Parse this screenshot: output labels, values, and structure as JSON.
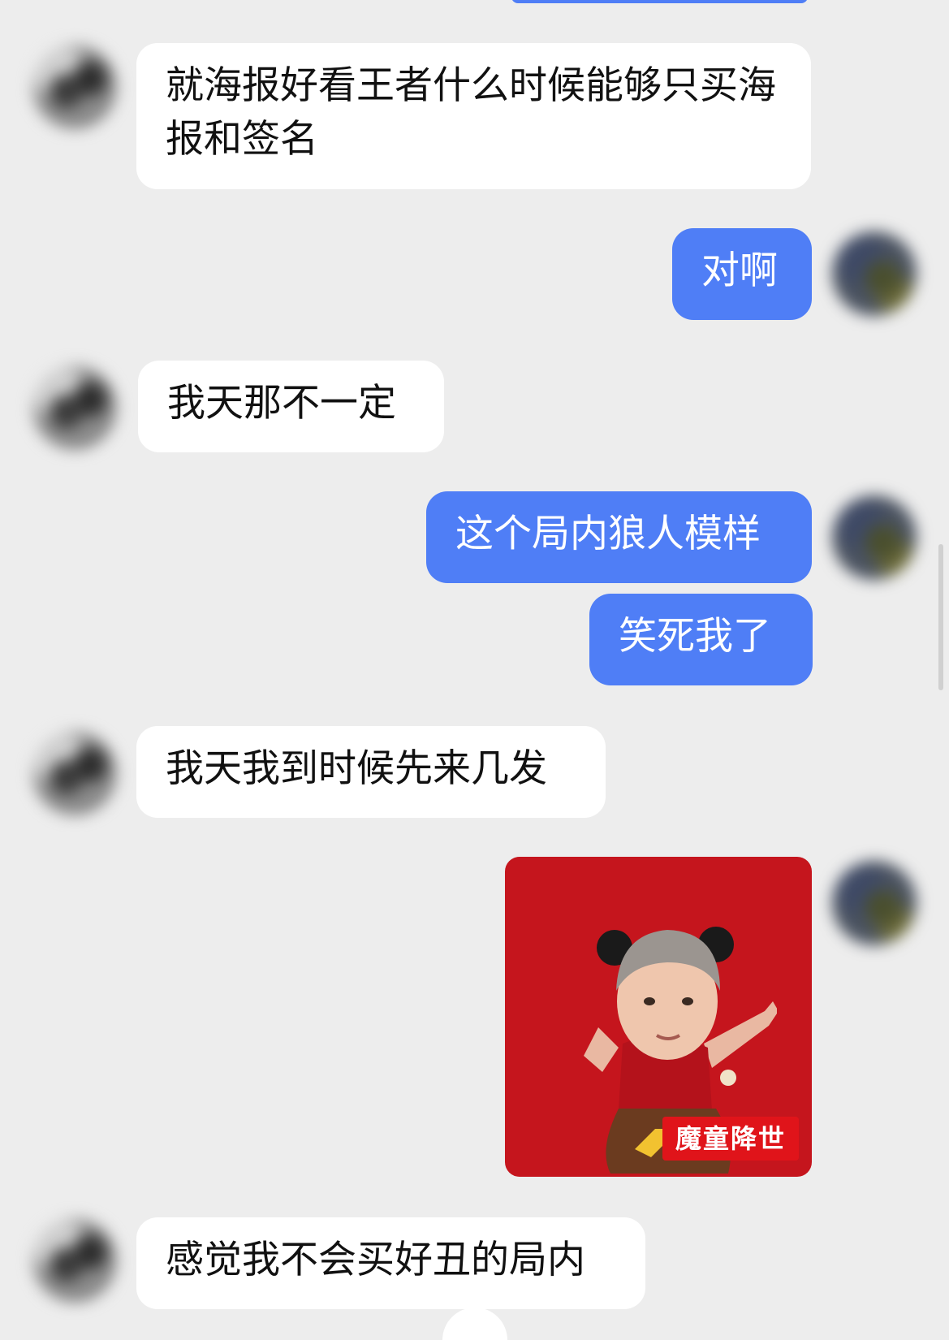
{
  "messages": [
    {
      "side": "in",
      "text": "就海报好看王者什么时候能够只买海报和签名"
    },
    {
      "side": "out",
      "text": "对啊"
    },
    {
      "side": "in",
      "text": "我天那不一定"
    },
    {
      "side": "out",
      "text": "这个局内狼人模样"
    },
    {
      "side": "out",
      "text": "笑死我了"
    },
    {
      "side": "in",
      "text": "我天我到时候先来几发"
    },
    {
      "side": "out",
      "sticker_caption": "魔童降世"
    },
    {
      "side": "in",
      "text": "感觉我不会买好丑的局内"
    }
  ],
  "colors": {
    "background": "#ededed",
    "incoming_bubble": "#ffffff",
    "outgoing_bubble": "#4f7ef6",
    "sticker_background": "#c5151d"
  }
}
